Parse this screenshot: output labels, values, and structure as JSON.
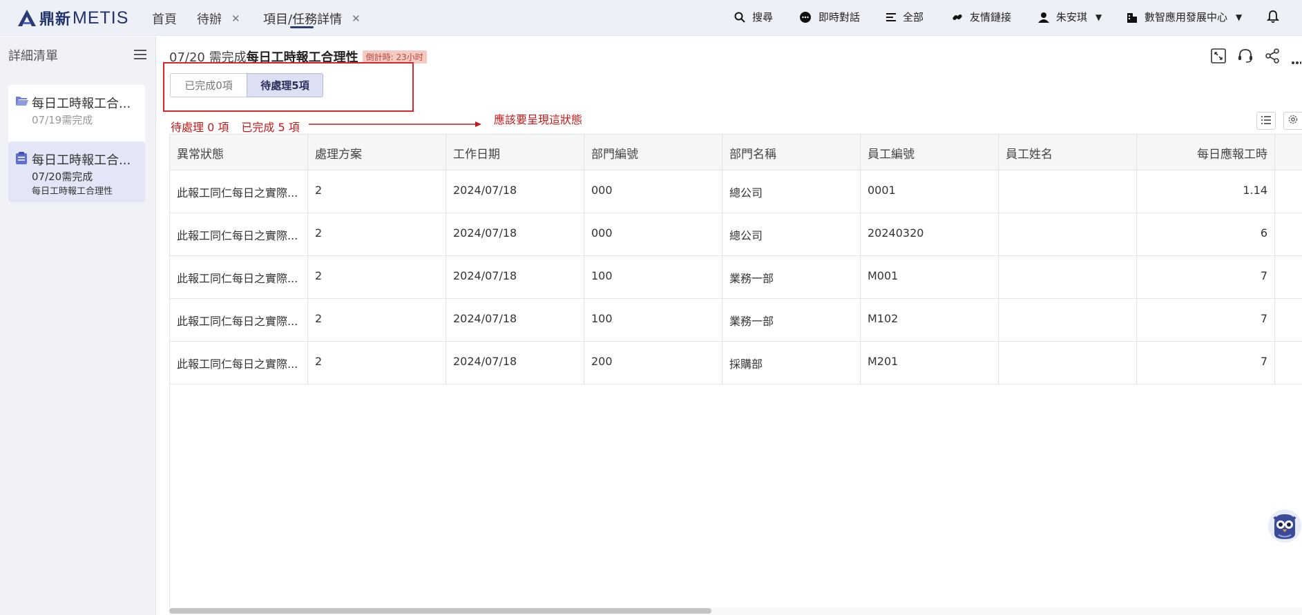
{
  "brand": {
    "cn": "鼎新",
    "en": "METIS"
  },
  "nav": {
    "tabs": [
      {
        "label": "首頁",
        "closable": false
      },
      {
        "label": "待辦",
        "closable": true
      },
      {
        "label": "項目/任務詳情",
        "closable": true
      }
    ],
    "tools": {
      "search": "搜尋",
      "chat": "即時對話",
      "all": "全部",
      "links": "友情鏈接",
      "user": "朱安琪",
      "org": "數智應用發展中心"
    }
  },
  "sidebar": {
    "title": "詳細清單",
    "cards": [
      {
        "title": "每日工時報工合...",
        "date": "07/19需完成",
        "sub": ""
      },
      {
        "title": "每日工時報工合...",
        "date": "07/20需完成",
        "sub": "每日工時報工合理性"
      }
    ]
  },
  "main": {
    "title_prefix": "07/20 需完成",
    "title": "每日工時報工合理性",
    "countdown": "倒計時: 23小时",
    "segments": {
      "done": "已完成0項",
      "pending": "待處理5項"
    },
    "annotation": {
      "pending": "待處理 0 項",
      "done": "已完成 5 項",
      "note": "應該要呈現這狀態"
    }
  },
  "table": {
    "columns": [
      "異常狀態",
      "處理方案",
      "工作日期",
      "部門編號",
      "部門名稱",
      "員工編號",
      "員工姓名",
      "每日應報工時"
    ],
    "rows": [
      [
        "此報工同仁每日之實際...",
        "2",
        "2024/07/18",
        "000",
        "總公司",
        "0001",
        "",
        "1.14"
      ],
      [
        "此報工同仁每日之實際...",
        "2",
        "2024/07/18",
        "000",
        "總公司",
        "20240320",
        "",
        "6"
      ],
      [
        "此報工同仁每日之實際...",
        "2",
        "2024/07/18",
        "100",
        "業務一部",
        "M001",
        "",
        "7"
      ],
      [
        "此報工同仁每日之實際...",
        "2",
        "2024/07/18",
        "100",
        "業務一部",
        "M102",
        "",
        "7"
      ],
      [
        "此報工同仁每日之實際...",
        "2",
        "2024/07/18",
        "200",
        "採購部",
        "M201",
        "",
        "7"
      ]
    ]
  },
  "colors": {
    "accent": "#2b3b78",
    "annotation": "#c21a1a",
    "countdown_bg": "#f6c9c3"
  }
}
